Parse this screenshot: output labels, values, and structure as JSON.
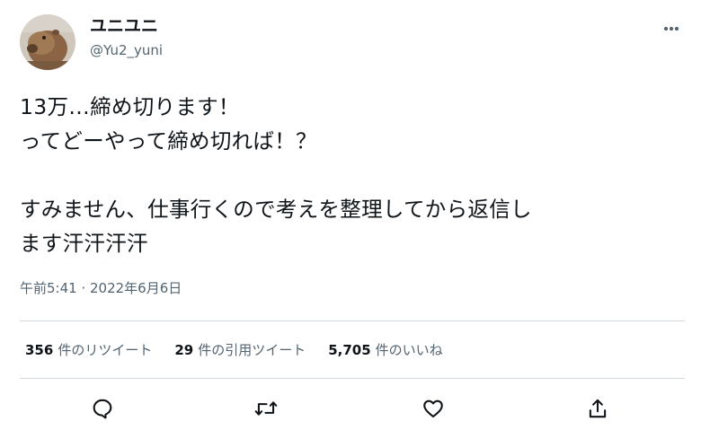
{
  "author": {
    "display_name": "ユニユニ",
    "handle": "@Yu2_yuni",
    "avatar_icon": "capybara-avatar"
  },
  "tweet": {
    "text": "13万…締め切ります！\nってどーやって締め切れば！？\n\nすみません、仕事行くので考えを整理してから返信し\nます汗汗汗汗",
    "timestamp": "午前5:41 · 2022年6月6日"
  },
  "stats": {
    "retweets": {
      "count": "356",
      "label": "件のリツイート"
    },
    "quotes": {
      "count": "29",
      "label": "件の引用ツイート"
    },
    "likes": {
      "count": "5,705",
      "label": "件のいいね"
    }
  },
  "actions": [
    "reply-icon",
    "retweet-icon",
    "like-icon",
    "share-icon"
  ],
  "colors": {
    "text": "#0f1419",
    "secondary": "#536471",
    "divider": "#cfd9de"
  }
}
